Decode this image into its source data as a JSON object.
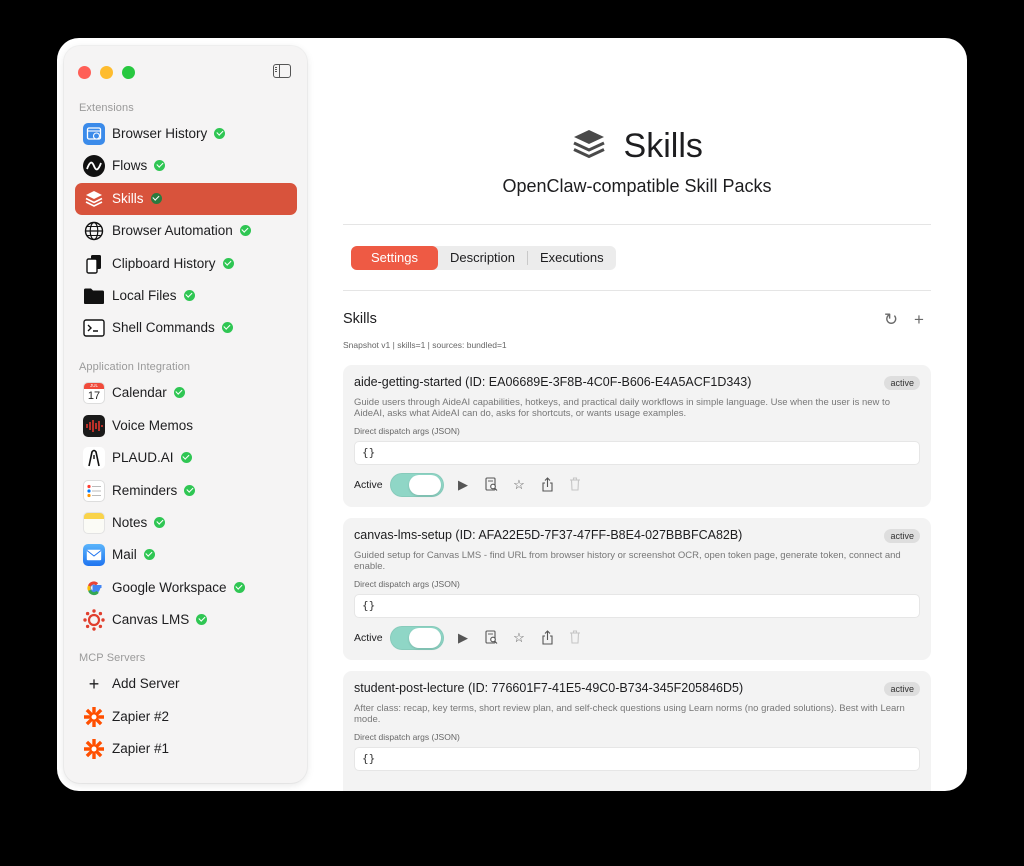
{
  "sidebar": {
    "sections": {
      "extensions": "Extensions",
      "app_integration": "Application Integration",
      "mcp_servers": "MCP Servers"
    },
    "items": [
      {
        "label": "Browser History",
        "icon": "browser-history-icon",
        "checked": true
      },
      {
        "label": "Flows",
        "icon": "flows-icon",
        "checked": true
      },
      {
        "label": "Skills",
        "icon": "skills-icon",
        "checked": true,
        "active": true
      },
      {
        "label": "Browser Automation",
        "icon": "globe-icon",
        "checked": true
      },
      {
        "label": "Clipboard History",
        "icon": "clipboard-icon",
        "checked": true
      },
      {
        "label": "Local Files",
        "icon": "folder-icon",
        "checked": true
      },
      {
        "label": "Shell Commands",
        "icon": "terminal-icon",
        "checked": true
      },
      {
        "label": "Calendar",
        "icon": "calendar-icon",
        "checked": true,
        "calendar_month": "JUL",
        "calendar_day": "17"
      },
      {
        "label": "Voice Memos",
        "icon": "voice-memos-icon",
        "checked": false
      },
      {
        "label": "PLAUD.AI",
        "icon": "plaud-icon",
        "checked": true
      },
      {
        "label": "Reminders",
        "icon": "reminders-icon",
        "checked": true
      },
      {
        "label": "Notes",
        "icon": "notes-icon",
        "checked": true
      },
      {
        "label": "Mail",
        "icon": "mail-icon",
        "checked": true
      },
      {
        "label": "Google Workspace",
        "icon": "google-icon",
        "checked": true
      },
      {
        "label": "Canvas LMS",
        "icon": "canvas-icon",
        "checked": true
      }
    ],
    "mcp": {
      "add_server": "Add Server",
      "servers": [
        "Zapier #2",
        "Zapier #1"
      ]
    }
  },
  "main": {
    "title": "Skills",
    "subtitle": "OpenClaw-compatible Skill Packs",
    "tabs": [
      "Settings",
      "Description",
      "Executions"
    ],
    "active_tab": "Settings",
    "skills_heading": "Skills",
    "skills_meta": "Snapshot v1 | skills=1 | sources: bundled=1",
    "args_label": "Direct dispatch args (JSON)",
    "active_label": "Active",
    "skills": [
      {
        "name": "aide-getting-started (ID: EA06689E-3F8B-4C0F-B606-E4A5ACF1D343)",
        "status": "active",
        "description": "Guide users through AideAI capabilities, hotkeys, and practical daily workflows in simple language. Use when the user is new to AideAI, asks what AideAI can do, asks for shortcuts, or wants usage examples.",
        "args": "{}",
        "enabled": true
      },
      {
        "name": "canvas-lms-setup (ID: AFA22E5D-7F37-47FF-B8E4-027BBBFCA82B)",
        "status": "active",
        "description": "Guided setup for Canvas LMS - find URL from browser history or screenshot OCR, open token page, generate token, connect and enable.",
        "args": "{}",
        "enabled": true
      },
      {
        "name": "student-post-lecture (ID: 776601F7-41E5-49C0-B734-345F205846D5)",
        "status": "active",
        "description": "After class: recap, key terms, short review plan, and self-check questions using Learn norms (no graded solutions). Best with Learn mode.",
        "args": "{}",
        "enabled": true
      }
    ]
  },
  "colors": {
    "accent": "#d8533c",
    "tab_active": "#ee5a44",
    "check": "#2fc653",
    "toggle_on": "#8fd6c6"
  }
}
